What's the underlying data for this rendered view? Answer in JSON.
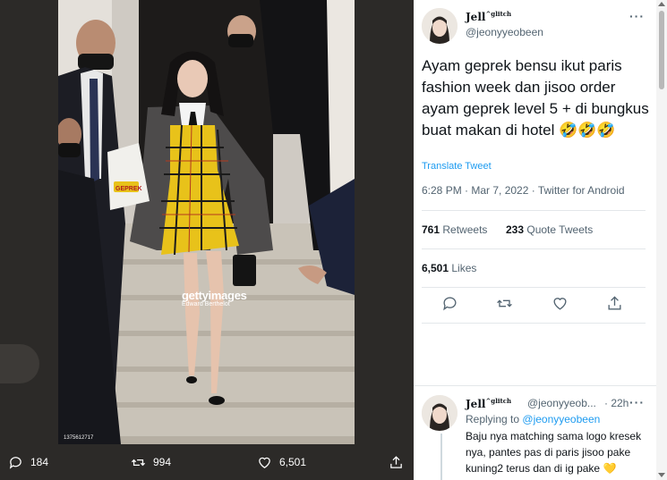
{
  "photo": {
    "watermark": "gettyimages",
    "credit": "Edward Berthelot",
    "image_id": "1375612717",
    "bag_logo": "GEPREK"
  },
  "actions": {
    "replies": "184",
    "retweets": "994",
    "likes": "6,501"
  },
  "tweet": {
    "author_name": "Jell",
    "author_sup": "^glitch",
    "author_handle": "@jeonyyeobeen",
    "more": "···",
    "text": "Ayam geprek bensu ikut paris fashion week dan jisoo order ayam geprek level 5 + di bungkus buat makan di hotel 🤣🤣🤣",
    "translate": "Translate Tweet",
    "meta": "6:28 PM · Mar 7, 2022 · Twitter for Android",
    "retweets_count": "761",
    "retweets_label": "Retweets",
    "quote_count": "233",
    "quote_label": "Quote Tweets",
    "likes_count": "6,501",
    "likes_label": "Likes"
  },
  "reply": {
    "author_name": "Jell",
    "author_sup": "^glitch",
    "author_handle": "@jeonyyeob...",
    "time": "· 22h",
    "replying_label": "Replying to",
    "replying_handle": "@jeonyyeobeen",
    "text": "Baju nya matching sama logo kresek nya, pantes pas di paris jisoo pake kuning2 terus dan di ig pake 💛 mulu, ternyata kode ke"
  },
  "colors": {
    "accent": "#1d9bf0",
    "viewer_bg": "#2c2a28",
    "plaid": "#e8c21a"
  }
}
